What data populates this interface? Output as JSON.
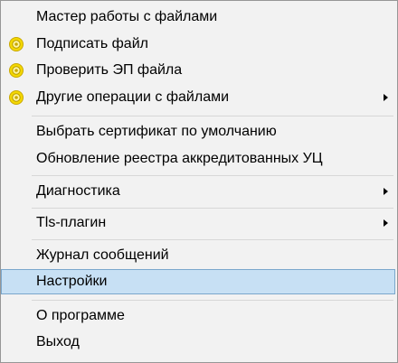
{
  "menu": {
    "items": [
      {
        "label": "Мастер работы с файлами"
      },
      {
        "label": "Подписать файл",
        "icon": "seal-gear-icon"
      },
      {
        "label": "Проверить ЭП файла",
        "icon": "seal-gear-icon"
      },
      {
        "label": "Другие операции с файлами",
        "icon": "seal-gear-icon",
        "submenu": true
      },
      {
        "label": "Выбрать сертификат по умолчанию"
      },
      {
        "label": "Обновление реестра аккредитованных УЦ"
      },
      {
        "label": "Диагностика",
        "submenu": true
      },
      {
        "label": "Tls-плагин",
        "submenu": true
      },
      {
        "label": "Журнал сообщений"
      },
      {
        "label": "Настройки",
        "highlighted": true
      },
      {
        "label": "О программе"
      },
      {
        "label": "Выход"
      }
    ]
  },
  "colors": {
    "menu_background": "#f2f2f2",
    "highlight_background": "#c7e0f4",
    "highlight_border": "#7aa7cc",
    "icon_yellow": "#f4d800"
  }
}
